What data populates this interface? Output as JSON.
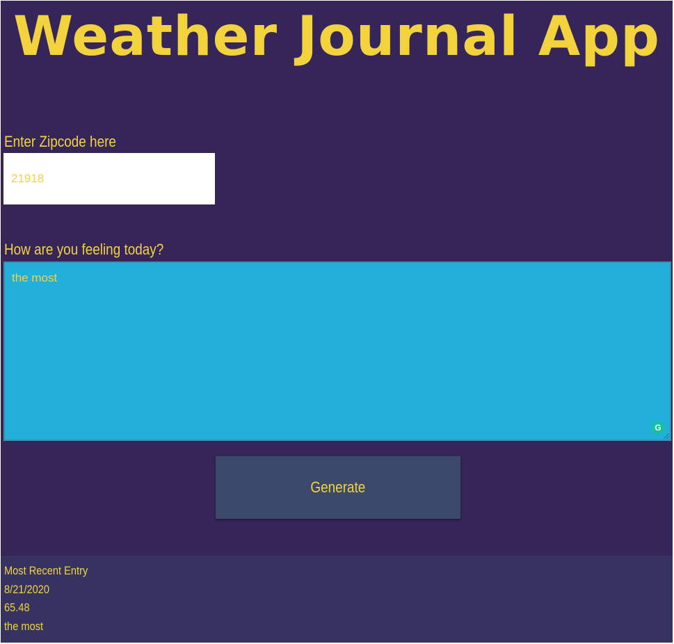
{
  "app": {
    "title": "Weather Journal App"
  },
  "form": {
    "zip_label": "Enter Zipcode here",
    "zip_value": "21918",
    "feelings_label": "How are you feeling today?",
    "feelings_value": "the most",
    "generate_label": "Generate"
  },
  "entry": {
    "heading": "Most Recent Entry",
    "date": "8/21/2020",
    "temp": "65.48",
    "content": "the most"
  },
  "colors": {
    "background": "#352558",
    "accent_text": "#f2d33d",
    "textarea_bg": "#22b0da",
    "button_bg": "#3b4a6a",
    "entry_panel_bg": "#363363",
    "grammarly_green": "#15c39a"
  },
  "icons": {
    "grammarly": "grammarly-icon",
    "resize": "resize-grip-icon"
  }
}
